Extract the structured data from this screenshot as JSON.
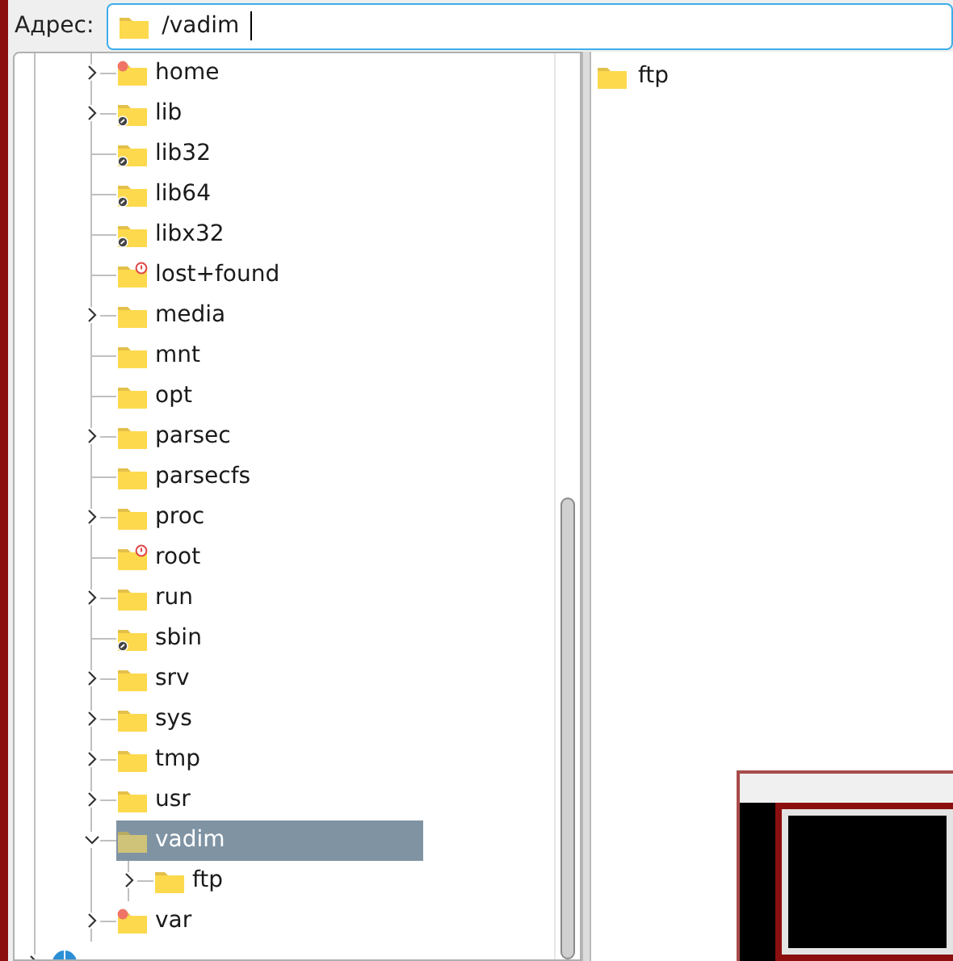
{
  "address_bar": {
    "label": "Адрес:",
    "value": "/vadim"
  },
  "tree": [
    {
      "name": "home",
      "expandable": true,
      "expanded": false,
      "symlink": false,
      "locked": false,
      "flagged": true,
      "selected": false
    },
    {
      "name": "lib",
      "expandable": true,
      "expanded": false,
      "symlink": true,
      "locked": false,
      "flagged": false,
      "selected": false
    },
    {
      "name": "lib32",
      "expandable": false,
      "expanded": false,
      "symlink": true,
      "locked": false,
      "flagged": false,
      "selected": false
    },
    {
      "name": "lib64",
      "expandable": false,
      "expanded": false,
      "symlink": true,
      "locked": false,
      "flagged": false,
      "selected": false
    },
    {
      "name": "libx32",
      "expandable": false,
      "expanded": false,
      "symlink": true,
      "locked": false,
      "flagged": false,
      "selected": false
    },
    {
      "name": "lost+found",
      "expandable": false,
      "expanded": false,
      "symlink": false,
      "locked": true,
      "flagged": false,
      "selected": false
    },
    {
      "name": "media",
      "expandable": true,
      "expanded": false,
      "symlink": false,
      "locked": false,
      "flagged": false,
      "selected": false
    },
    {
      "name": "mnt",
      "expandable": false,
      "expanded": false,
      "symlink": false,
      "locked": false,
      "flagged": false,
      "selected": false
    },
    {
      "name": "opt",
      "expandable": false,
      "expanded": false,
      "symlink": false,
      "locked": false,
      "flagged": false,
      "selected": false
    },
    {
      "name": "parsec",
      "expandable": true,
      "expanded": false,
      "symlink": false,
      "locked": false,
      "flagged": false,
      "selected": false
    },
    {
      "name": "parsecfs",
      "expandable": false,
      "expanded": false,
      "symlink": false,
      "locked": false,
      "flagged": false,
      "selected": false
    },
    {
      "name": "proc",
      "expandable": true,
      "expanded": false,
      "symlink": false,
      "locked": false,
      "flagged": false,
      "selected": false
    },
    {
      "name": "root",
      "expandable": false,
      "expanded": false,
      "symlink": false,
      "locked": true,
      "flagged": false,
      "selected": false
    },
    {
      "name": "run",
      "expandable": true,
      "expanded": false,
      "symlink": false,
      "locked": false,
      "flagged": false,
      "selected": false
    },
    {
      "name": "sbin",
      "expandable": false,
      "expanded": false,
      "symlink": true,
      "locked": false,
      "flagged": false,
      "selected": false
    },
    {
      "name": "srv",
      "expandable": true,
      "expanded": false,
      "symlink": false,
      "locked": false,
      "flagged": false,
      "selected": false
    },
    {
      "name": "sys",
      "expandable": true,
      "expanded": false,
      "symlink": false,
      "locked": false,
      "flagged": false,
      "selected": false
    },
    {
      "name": "tmp",
      "expandable": true,
      "expanded": false,
      "symlink": false,
      "locked": false,
      "flagged": false,
      "selected": false
    },
    {
      "name": "usr",
      "expandable": true,
      "expanded": false,
      "symlink": false,
      "locked": false,
      "flagged": false,
      "selected": false
    },
    {
      "name": "vadim",
      "expandable": true,
      "expanded": true,
      "symlink": false,
      "locked": false,
      "flagged": false,
      "selected": true,
      "children": [
        {
          "name": "ftp",
          "expandable": true,
          "expanded": false,
          "symlink": false,
          "locked": false,
          "flagged": false,
          "selected": false
        }
      ]
    },
    {
      "name": "var",
      "expandable": true,
      "expanded": false,
      "symlink": false,
      "locked": false,
      "flagged": true,
      "selected": false
    }
  ],
  "files": [
    {
      "name": "ftp"
    }
  ]
}
